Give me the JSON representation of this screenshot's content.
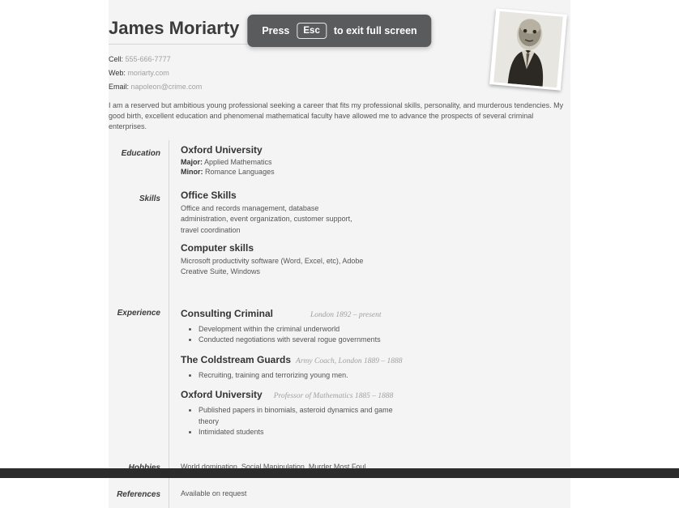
{
  "fullscreen": {
    "press": "Press",
    "key": "Esc",
    "rest": "to exit full screen"
  },
  "name": "James Moriarty",
  "contacts": {
    "cell_label": "Cell:",
    "cell_value": "555-666-7777",
    "web_label": "Web:",
    "web_value": "moriarty.com",
    "email_label": "Email:",
    "email_value": "napoleon@crime.com"
  },
  "summary": "I am a reserved but ambitious young professional seeking a career that fits my professional skills, personality, and murderous tendencies. My good birth, excellent education and phenomenal mathematical faculty have allowed me to advance the prospects of several criminal enterprises.",
  "section_labels": {
    "education": "Education",
    "skills": "Skills",
    "experience": "Experience",
    "hobbies": "Hobbies",
    "references": "References"
  },
  "education": {
    "school": "Oxford University",
    "major_label": "Major:",
    "major_value": "Applied Mathematics",
    "minor_label": "Minor:",
    "minor_value": "Romance Languages"
  },
  "skills": {
    "group1_title": "Office Skills",
    "group1_desc": "Office and records management, database administration, event organization, customer support, travel coordination",
    "group2_title": "Computer skills",
    "group2_desc": "Microsoft productivity software (Word, Excel, etc), Adobe Creative Suite, Windows"
  },
  "experience": {
    "job1_title": "Consulting Criminal",
    "job1_sub": "London 1892 – present",
    "job1_b1": "Development within the criminal underworld",
    "job1_b2": "Conducted negotiations with several rogue governments",
    "job2_title": "The Coldstream Guards",
    "job2_sub": "Army Coach, London 1889 – 1888",
    "job2_b1": "Recruiting, training and terrorizing young men.",
    "job3_title": "Oxford University",
    "job3_sub": "Professor of Mathematics 1885 – 1888",
    "job3_b1": "Published papers in binomials, asteroid dynamics and game theory",
    "job3_b2": "Intimidated students"
  },
  "hobbies": "World domination, Social Manipulation, Murder Most Foul",
  "references": "Available on request"
}
